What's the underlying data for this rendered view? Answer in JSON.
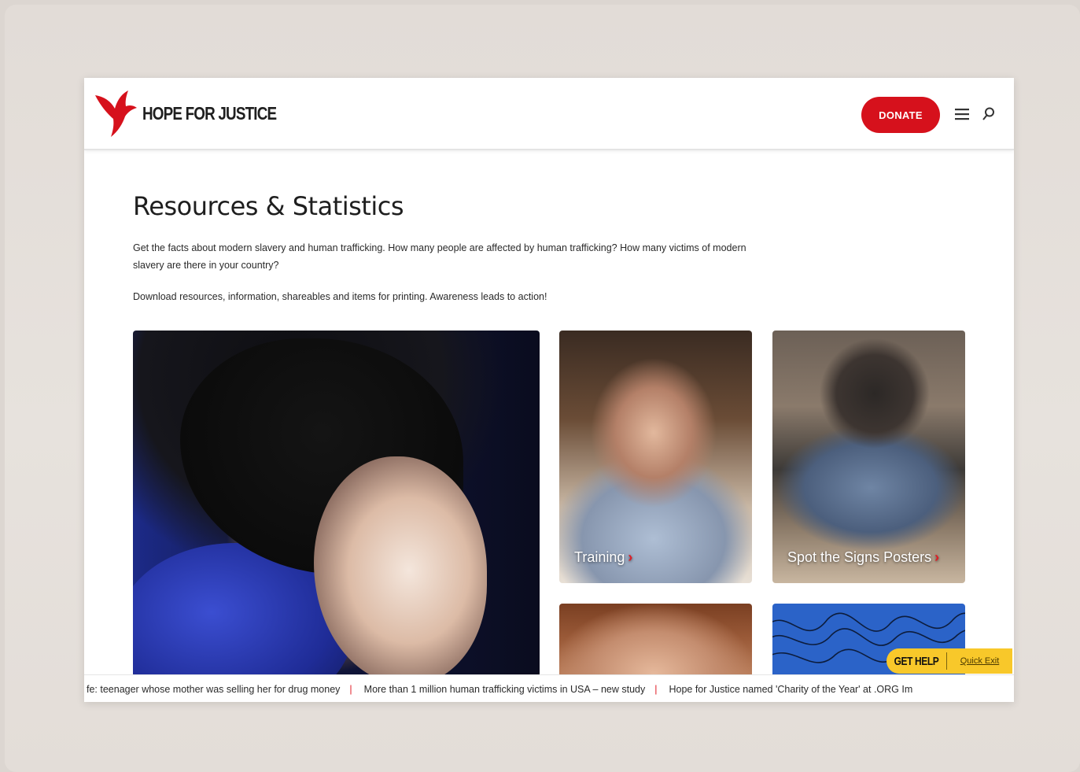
{
  "brand": {
    "name": "HOPE FOR JUSTICE",
    "accent_color": "#d6111c"
  },
  "header": {
    "donate_label": "DONATE",
    "menu_icon": "hamburger-menu-icon",
    "search_icon": "search-icon"
  },
  "main": {
    "title": "Resources & Statistics",
    "intro": "Get the facts about modern slavery and human trafficking. How many people are affected by human trafficking? How many victims of modern slavery are there in your country?",
    "intro2": "Download resources, information, shareables and items for printing. Awareness leads to action!"
  },
  "cards": [
    {
      "label": ""
    },
    {
      "label": "Training"
    },
    {
      "label": "Spot the Signs Posters"
    },
    {
      "label": ""
    },
    {
      "label": ""
    }
  ],
  "help_widget": {
    "get_help": "GET HELP",
    "quick_exit": "Quick Exit",
    "color": "#f8c82a"
  },
  "ticker": [
    "fe: teenager whose mother was selling her for drug money",
    "More than 1 million human trafficking victims in USA – new study",
    "Hope for Justice named 'Charity of the Year' at .ORG Im"
  ]
}
